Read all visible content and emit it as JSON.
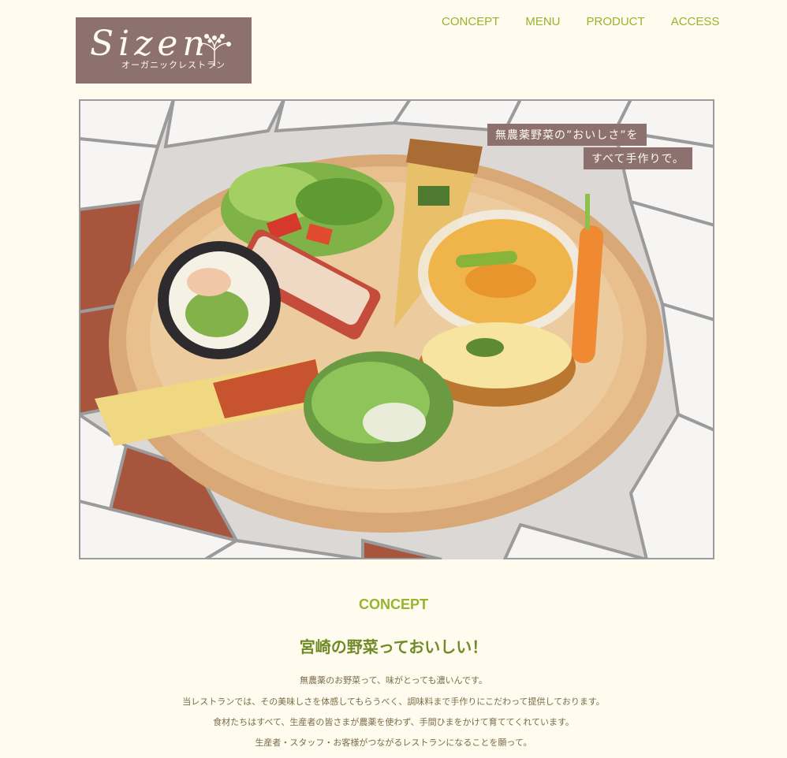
{
  "brand": {
    "logo_word": "Sizen",
    "logo_sub": "オーガニックレストラン"
  },
  "nav": {
    "items": [
      {
        "label": "CONCEPT"
      },
      {
        "label": "MENU"
      },
      {
        "label": "PRODUCT"
      },
      {
        "label": "ACCESS"
      }
    ]
  },
  "hero": {
    "caption_line1": "無農薬野菜の”おいしさ”を",
    "caption_line2": "すべて手作りで。"
  },
  "concept": {
    "heading": "CONCEPT",
    "title": "宮崎の野菜っておいしい！",
    "paragraphs": [
      "無農薬のお野菜って、味がとっても濃いんです。",
      "当レストランでは、その美味しさを体感してもらうべく、調味料まで手作りにこだわって提供しております。",
      "食材たちはすべて、生産者の皆さまが農薬を使わず、手間ひまをかけて育ててくれています。",
      "生産者・スタッフ・お客様がつながるレストランになることを願って。"
    ]
  },
  "colors": {
    "background": "#fffbee",
    "accent_green": "#98b32e",
    "title_green": "#6f8a26",
    "logo_brown": "#8c716f",
    "body_text": "#7a6d48"
  }
}
